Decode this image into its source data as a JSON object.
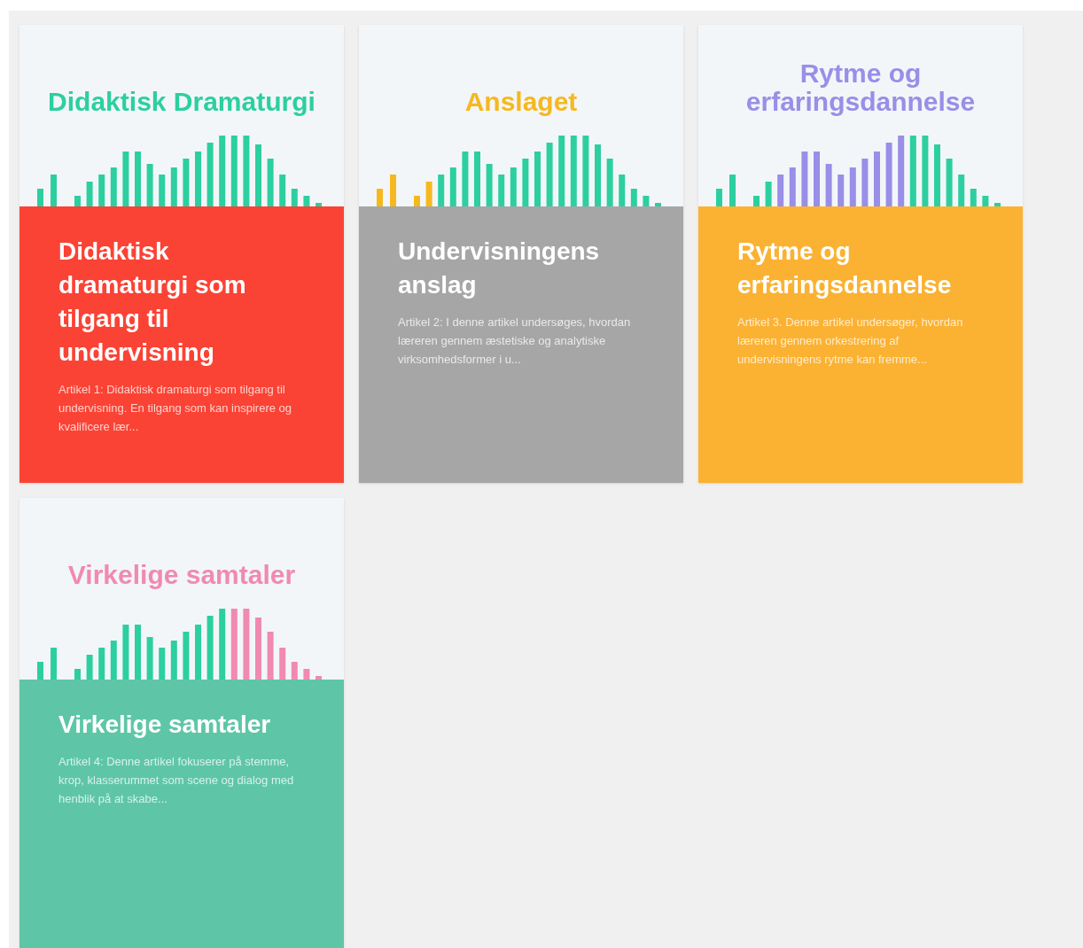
{
  "cards": [
    {
      "heading": {
        "text": "Didaktisk Dramaturgi",
        "color": "#2ccfa0"
      },
      "panel": {
        "color": "#fa4335"
      },
      "title": "Didaktisk dramaturgi som tilgang til undervisning",
      "excerpt": "Artikel 1: Didaktisk dramaturgi som tilgang til undervisning. En tilgang som kan inspirere og kvalificere lær..."
    },
    {
      "heading": {
        "text": "Anslaget",
        "color": "#f5b81f"
      },
      "panel": {
        "color": "#a6a6a6"
      },
      "title": "Undervisningens anslag",
      "excerpt": "Artikel 2: I denne artikel undersøges, hvordan læreren gennem æstetiske og analytiske virksomhedsformer i u..."
    },
    {
      "heading": {
        "text": "Rytme og erfaringsdannelse",
        "color": "#9a8ee8"
      },
      "panel": {
        "color": "#fbb232"
      },
      "title": "Rytme og erfaringsdannelse",
      "excerpt": "Artikel 3. Denne artikel undersøger, hvordan læreren gennem orkestrering af undervisningens rytme kan fremme..."
    },
    {
      "heading": {
        "text": "Virkelige samtaler",
        "color": "#f08ab0"
      },
      "panel": {
        "color": "#5ec6a6"
      },
      "title": "Virkelige samtaler",
      "excerpt": "Artikel 4: Denne artikel fokuserer på stemme, krop, klasserummet som scene og dialog med henblik på at skabe..."
    }
  ]
}
